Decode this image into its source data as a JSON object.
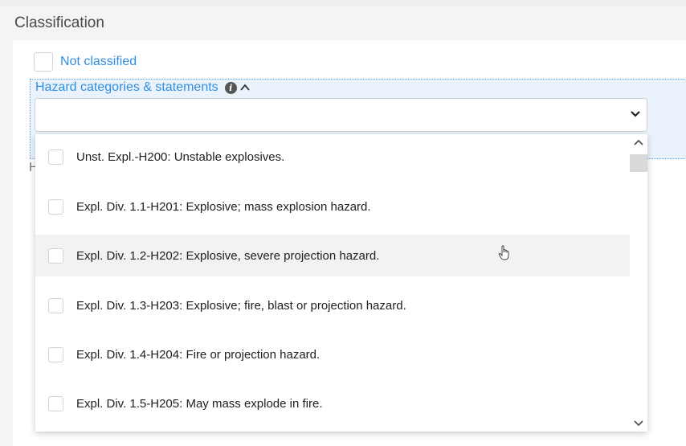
{
  "section": {
    "title": "Classification"
  },
  "not_classified": {
    "label": "Not classified",
    "checked": false
  },
  "hazard_field": {
    "label": "Hazard categories & statements",
    "info_icon": "info-icon",
    "collapse_icon": "chevron-up-icon",
    "select_value": "",
    "dropdown_icon": "chevron-down-icon"
  },
  "background_fragment": "H",
  "dropdown": {
    "options": [
      {
        "label": "Unst. Expl.-H200: Unstable explosives.",
        "checked": false
      },
      {
        "label": "Expl. Div. 1.1-H201: Explosive; mass explosion hazard.",
        "checked": false
      },
      {
        "label": "Expl. Div. 1.2-H202: Explosive, severe projection hazard.",
        "checked": false,
        "hovered": true
      },
      {
        "label": "Expl. Div. 1.3-H203: Explosive; fire, blast or projection hazard.",
        "checked": false
      },
      {
        "label": "Expl. Div. 1.4-H204: Fire or projection hazard.",
        "checked": false
      },
      {
        "label": "Expl. Div. 1.5-H205: May mass explode in fire.",
        "checked": false
      }
    ]
  },
  "colors": {
    "accent": "#2f8fe0",
    "hover_row": "#f2f2f2",
    "field_bg": "#eaf3fc"
  }
}
